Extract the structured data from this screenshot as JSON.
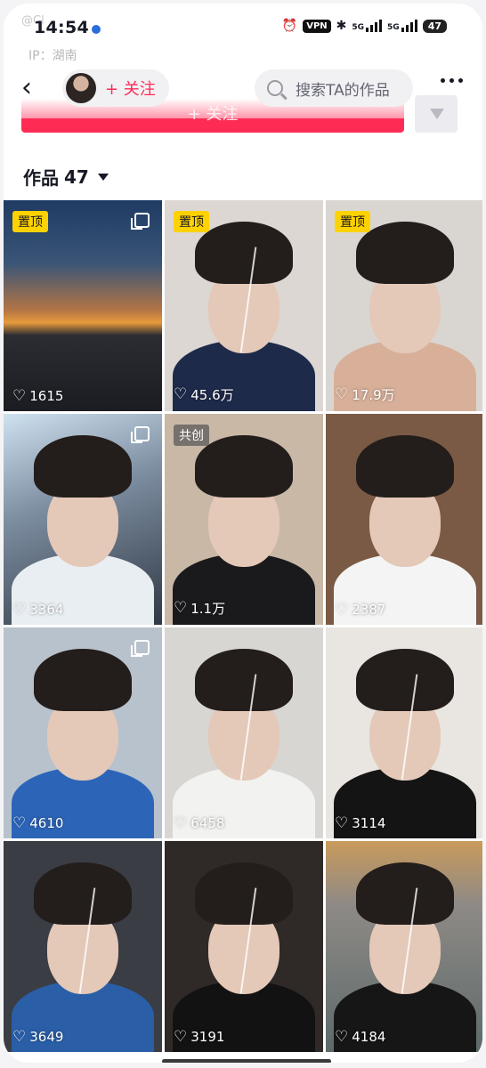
{
  "status_bar": {
    "time": "14:54",
    "vpn": "VPN",
    "net1": "5G",
    "net2": "5G",
    "battery": "47"
  },
  "ghost": {
    "handle": "@Cl",
    "ip": "IP：湖南"
  },
  "header": {
    "follow_label": "+ 关注",
    "search_placeholder": "搜索TA的作品",
    "big_follow_label": "+ 关注"
  },
  "tab": {
    "label": "作品",
    "count": "47"
  },
  "colors": {
    "accent": "#fe2c55",
    "pin_badge": "#fdd200"
  },
  "videos": [
    {
      "badge": "置顶",
      "badge_type": "pin",
      "multi": true,
      "likes": "1615",
      "bg": "linear-gradient(180deg,#1f3b63 0%,#3a5577 30%,#b27445 52%,#e89a3c 58%,#2c2d33 64%,#1a1c22 100%)",
      "face": false
    },
    {
      "badge": "置顶",
      "badge_type": "pin",
      "multi": false,
      "likes": "45.6万",
      "bg": "#dcd7d2",
      "face": true,
      "shirt": "#1e2a4a",
      "crack": true
    },
    {
      "badge": "置顶",
      "badge_type": "pin",
      "multi": false,
      "likes": "17.9万",
      "bg": "#d9d6d2",
      "face": true,
      "shirt": "#d8b09a"
    },
    {
      "badge": "",
      "badge_type": "",
      "multi": true,
      "likes": "3364",
      "bg": "linear-gradient(160deg,#cfe2f0 0%,#7e8fa2 40%,#2f3844 100%)",
      "face": true,
      "shirt": "#e9eef2"
    },
    {
      "badge": "共创",
      "badge_type": "co",
      "multi": false,
      "likes": "1.1万",
      "bg": "#c9b8a6",
      "face": true,
      "shirt": "#1a1a1c"
    },
    {
      "badge": "",
      "badge_type": "",
      "multi": false,
      "likes": "2387",
      "bg": "#7a5a44",
      "face": true,
      "shirt": "#f4f4f4"
    },
    {
      "badge": "",
      "badge_type": "",
      "multi": true,
      "likes": "4610",
      "bg": "#b8c2cc",
      "face": true,
      "shirt": "#2c65b8"
    },
    {
      "badge": "",
      "badge_type": "",
      "multi": false,
      "likes": "6458",
      "bg": "#d8d6d3",
      "face": true,
      "shirt": "#f2f2f0",
      "crack": true
    },
    {
      "badge": "",
      "badge_type": "",
      "multi": false,
      "likes": "3114",
      "bg": "#e9e6e2",
      "face": true,
      "shirt": "#141414",
      "crack": true
    },
    {
      "badge": "",
      "badge_type": "",
      "multi": false,
      "likes": "3649",
      "bg": "#3a3d44",
      "face": true,
      "shirt": "#2a5fa8",
      "crack": true
    },
    {
      "badge": "",
      "badge_type": "",
      "multi": false,
      "likes": "3191",
      "bg": "#2f2a28",
      "face": true,
      "shirt": "#121212",
      "crack": true
    },
    {
      "badge": "",
      "badge_type": "",
      "multi": false,
      "likes": "4184",
      "bg": "linear-gradient(180deg,#c99a5c 0%,#8e8a86 30%,#5d6a6a 100%)",
      "face": true,
      "shirt": "#161616",
      "crack": true
    }
  ]
}
